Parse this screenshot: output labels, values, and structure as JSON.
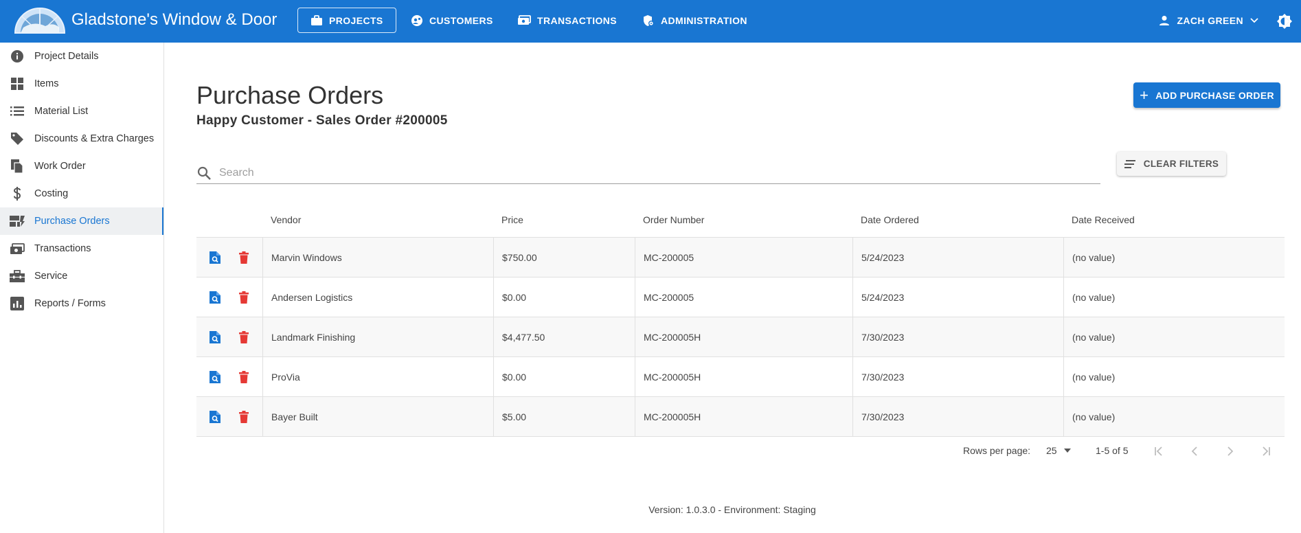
{
  "app": {
    "title": "Gladstone's Window & Door"
  },
  "nav": {
    "projects": "PROJECTS",
    "customers": "CUSTOMERS",
    "transactions": "TRANSACTIONS",
    "administration": "ADMINISTRATION"
  },
  "user": {
    "name": "ZACH GREEN"
  },
  "sidebar": {
    "items": [
      {
        "label": "Project Details",
        "icon": "info-icon"
      },
      {
        "label": "Items",
        "icon": "grid-icon"
      },
      {
        "label": "Material List",
        "icon": "list-icon"
      },
      {
        "label": "Discounts & Extra Charges",
        "icon": "tag-icon"
      },
      {
        "label": "Work Order",
        "icon": "documents-icon"
      },
      {
        "label": "Costing",
        "icon": "dollar-icon"
      },
      {
        "label": "Purchase Orders",
        "icon": "purchase-orders-icon",
        "active": true
      },
      {
        "label": "Transactions",
        "icon": "cash-icon"
      },
      {
        "label": "Service",
        "icon": "toolbox-icon"
      },
      {
        "label": "Reports / Forms",
        "icon": "report-icon"
      }
    ]
  },
  "page": {
    "title": "Purchase Orders",
    "subtitle": "Happy Customer - Sales Order #200005",
    "add_button": "ADD PURCHASE ORDER",
    "clear_filters": "CLEAR FILTERS",
    "search_placeholder": "Search"
  },
  "table": {
    "columns": [
      "Vendor",
      "Price",
      "Order Number",
      "Date Ordered",
      "Date Received"
    ],
    "rows": [
      {
        "vendor": "Marvin Windows",
        "price": "$750.00",
        "order_number": "MC-200005",
        "date_ordered": "5/24/2023",
        "date_received": "(no value)"
      },
      {
        "vendor": "Andersen Logistics",
        "price": "$0.00",
        "order_number": "MC-200005",
        "date_ordered": "5/24/2023",
        "date_received": "(no value)"
      },
      {
        "vendor": "Landmark Finishing",
        "price": "$4,477.50",
        "order_number": "MC-200005H",
        "date_ordered": "7/30/2023",
        "date_received": "(no value)"
      },
      {
        "vendor": "ProVia",
        "price": "$0.00",
        "order_number": "MC-200005H",
        "date_ordered": "7/30/2023",
        "date_received": "(no value)"
      },
      {
        "vendor": "Bayer Built",
        "price": "$5.00",
        "order_number": "MC-200005H",
        "date_ordered": "7/30/2023",
        "date_received": "(no value)"
      }
    ]
  },
  "pagination": {
    "rows_per_page_label": "Rows per page:",
    "rows_per_page": "25",
    "range": "1-5 of 5"
  },
  "footer": {
    "version": "Version: 1.0.3.0 - Environment: Staging"
  },
  "colors": {
    "primary": "#1976d2",
    "delete": "#e53935",
    "view": "#1976d2"
  }
}
